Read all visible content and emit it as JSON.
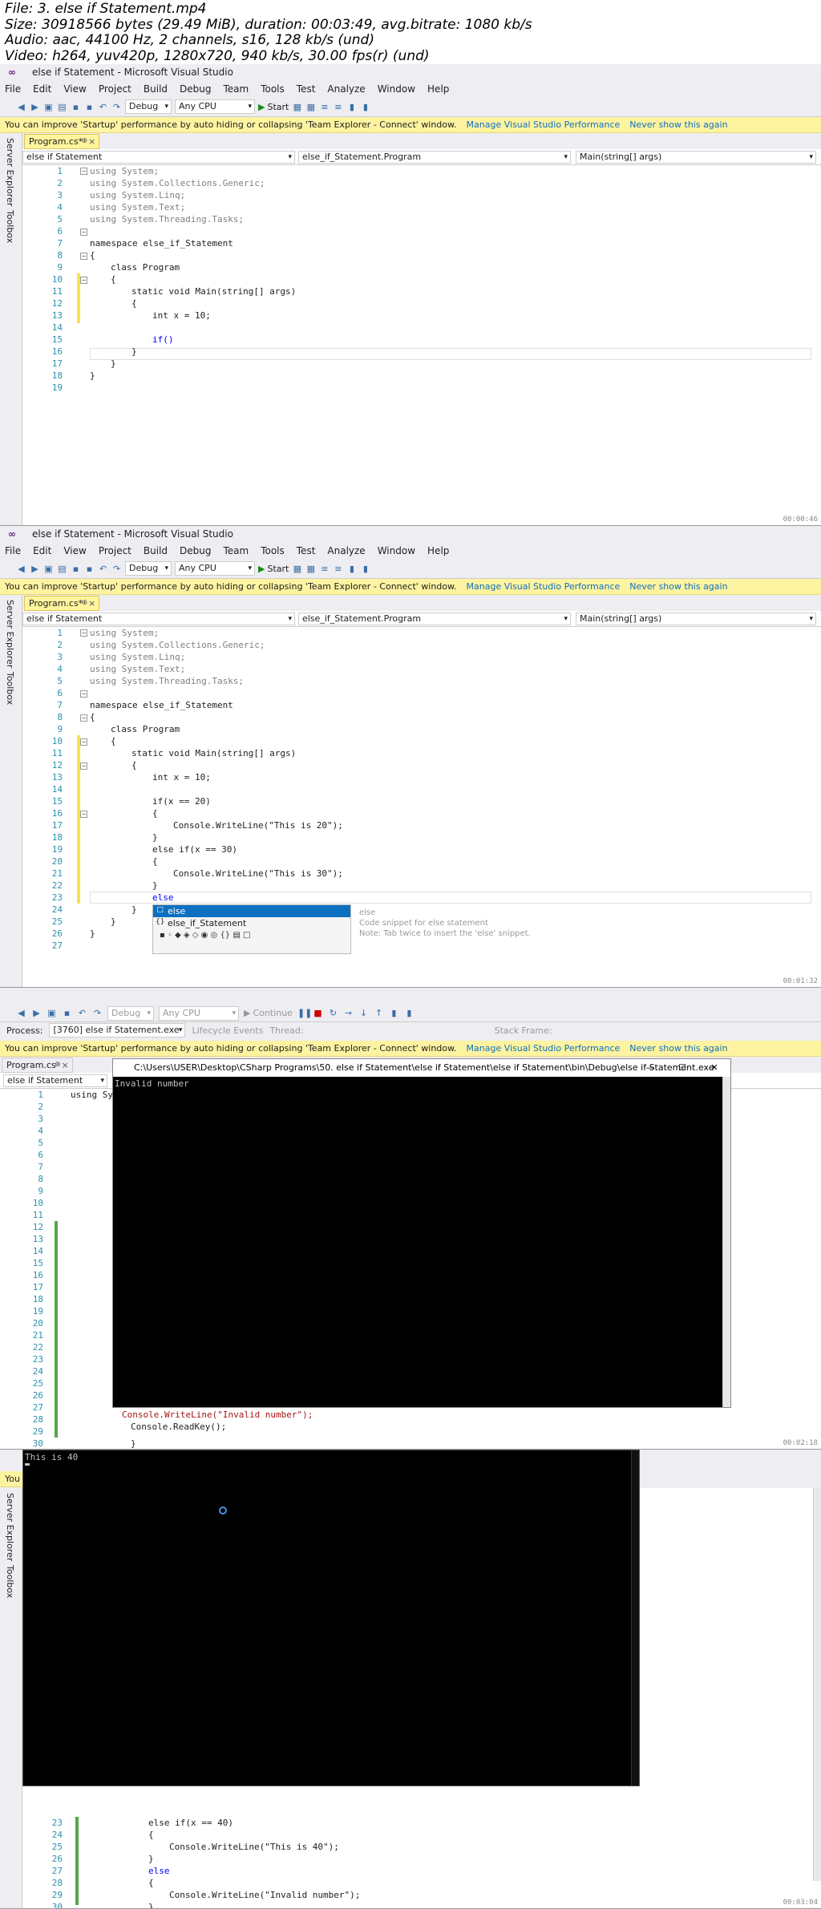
{
  "header": {
    "file": "File: 3. else if Statement.mp4",
    "size": "Size: 30918566 bytes (29.49 MiB), duration: 00:03:49, avg.bitrate: 1080 kb/s",
    "audio": "Audio: aac, 44100 Hz, 2 channels, s16, 128 kb/s (und)",
    "video": "Video: h264, yuv420p, 1280x720, 940 kb/s, 30.00 fps(r) (und)"
  },
  "vs": {
    "window_title": "else if Statement - Microsoft Visual Studio",
    "menu": [
      "File",
      "Edit",
      "View",
      "Project",
      "Build",
      "Debug",
      "Team",
      "Tools",
      "Test",
      "Analyze",
      "Window",
      "Help"
    ],
    "config": "Debug",
    "platform": "Any CPU",
    "start": "Start",
    "continue": "Continue",
    "info_msg": "You can improve 'Startup' performance by auto hiding or collapsing 'Team Explorer - Connect' window.",
    "info_link1": "Manage Visual Studio Performance",
    "info_link2": "Never show this again",
    "side_server": "Server Explorer",
    "side_toolbox": "Toolbox",
    "tab": "Program.cs*",
    "tab_plain": "Program.cs",
    "nav_project": "else if Statement",
    "nav_class": "else_if_Statement.Program",
    "nav_member": "Main(string[] args)",
    "process_label": "Process:",
    "process_value": "[3760] else if Statement.exe",
    "lifecycle": "Lifecycle Events",
    "thread": "Thread:",
    "stackframe": "Stack Frame:"
  },
  "code": {
    "using1": "using System;",
    "using2": "using System.Collections.Generic;",
    "using3": "using System.Linq;",
    "using4": "using System.Text;",
    "using5": "using System.Threading.Tasks;",
    "ns": "namespace else_if_Statement",
    "ob": "{",
    "cb": "}",
    "cls": "class Program",
    "main": "static void Main(string[] args)",
    "intx": "int x = 10;",
    "if_empty": "if()",
    "if20": "if(x == 20)",
    "wl20": "Console.WriteLine(\"This is 20\");",
    "elseif30": "else if(x == 30)",
    "wl30": "Console.WriteLine(\"This is 30\");",
    "else_kw": "else",
    "elseif40": "else if(x == 40)",
    "wl40": "Console.WriteLine(\"This is 40\");",
    "wlinv": "Console.WriteLine(\"Invalid number\");",
    "readkey": "Console.ReadKey();",
    "partial_sy": "using Sy"
  },
  "autocomplete": {
    "item1": "else",
    "item2": "else_if_Statement",
    "tip1": "else",
    "tip2": "Code snippet for else statement",
    "tip3": "Note: Tab twice to insert the 'else' snippet."
  },
  "console": {
    "path": "C:\\Users\\USER\\Desktop\\CSharp Programs\\50. else if Statement\\else if Statement\\else if Statement\\bin\\Debug\\else if Statement.exe",
    "out1": "Invalid number",
    "out2": "This is 40"
  },
  "frame4": {
    "info_partial": "You"
  },
  "timestamps": [
    "00:00:46",
    "00:01:32",
    "00:02:18",
    "00:03:04"
  ],
  "colors": {
    "keyword": "#0000ff",
    "type": "#2b91af",
    "string": "#a31515",
    "infobar": "#fdf3a1"
  }
}
